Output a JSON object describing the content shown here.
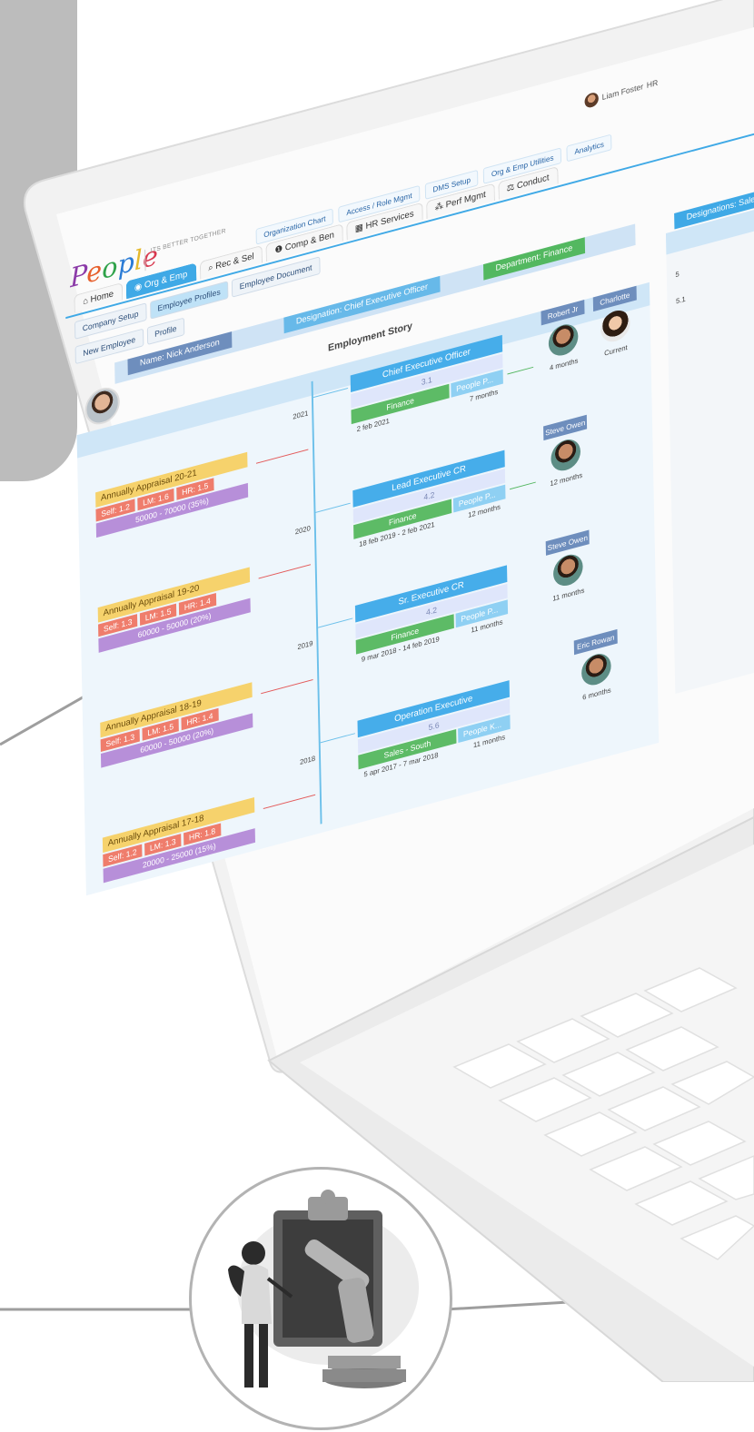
{
  "app": {
    "logo_text": "People",
    "tagline": "ITS BETTER TOGETHER",
    "user": {
      "name": "Liam Foster",
      "role": "HR"
    }
  },
  "main_nav": [
    {
      "label": "Home",
      "icon": "home-icon"
    },
    {
      "label": "Org & Emp",
      "icon": "user-icon"
    },
    {
      "label": "Rec & Sel",
      "icon": "search-icon"
    },
    {
      "label": "Comp & Ben",
      "icon": "coin-icon"
    },
    {
      "label": "HR Services",
      "icon": "calendar-icon"
    },
    {
      "label": "Perf Mgmt",
      "icon": "chart-icon"
    },
    {
      "label": "Conduct",
      "icon": "gavel-icon"
    }
  ],
  "sub_nav": [
    "Organization Chart",
    "Access / Role Mgmt",
    "DMS Setup",
    "Org & Emp Utilities",
    "Analytics"
  ],
  "tabs_row1": [
    "Company Setup",
    "Employee Profiles",
    "Employee Document"
  ],
  "tabs_row2": [
    "New Employee",
    "Profile"
  ],
  "employee": {
    "name": "Name: Nick Anderson",
    "designation": "Designation: Chief Executive Officer",
    "department": "Department: Finance",
    "designation_right": "Designations: Sales Exec"
  },
  "story_title": "Employment Story",
  "years": [
    "2021",
    "2020",
    "2019",
    "2018"
  ],
  "appraisals": [
    {
      "title": "Annually Appraisal 20-21",
      "self": "Self: 1.2",
      "lm": "LM: 1.6",
      "hr": "HR: 1.5",
      "band": "50000 - 70000 (35%)"
    },
    {
      "title": "Annually Appraisal 19-20",
      "self": "Self: 1.3",
      "lm": "LM: 1.5",
      "hr": "HR: 1.4",
      "band": "60000 - 50000 (20%)"
    },
    {
      "title": "Annually Appraisal 18-19",
      "self": "Self: 1.3",
      "lm": "LM: 1.5",
      "hr": "HR: 1.4",
      "band": "60000 - 50000 (20%)"
    },
    {
      "title": "Annually Appraisal 17-18",
      "self": "Self: 1.2",
      "lm": "LM: 1.3",
      "hr": "HR: 1.8",
      "band": "20000 - 25000 (15%)"
    }
  ],
  "roles": [
    {
      "title": "Chief Executive Officer",
      "level": "3.1",
      "dept": "Finance",
      "unit": "People P...",
      "start": "2 feb 2021",
      "duration": "7 months"
    },
    {
      "title": "Lead Executive CR",
      "level": "4.2",
      "dept": "Finance",
      "unit": "People P...",
      "start": "18 feb 2019 - 2 feb 2021",
      "duration": "12 months"
    },
    {
      "title": "Sr. Executive CR",
      "level": "4.2",
      "dept": "Finance",
      "unit": "People P...",
      "start": "9 mar 2018 - 14 feb 2019",
      "duration": "11 months"
    },
    {
      "title": "Operation Executive",
      "level": "5.6",
      "dept": "Sales - South",
      "unit": "People K...",
      "start": "5 apr 2017 - 7 mar 2018",
      "duration": "11 months"
    }
  ],
  "managers": [
    {
      "name": "Robert Jr",
      "duration": "4 months"
    },
    {
      "name": "Charlotte",
      "duration": "Current"
    },
    {
      "name": "Steve Owen",
      "duration": "12 months"
    },
    {
      "name": "Steve Owen",
      "duration": "11 months"
    },
    {
      "name": "Eric Rowan",
      "duration": "6 months"
    }
  ],
  "right_panel": {
    "n1": "5",
    "n2": "5.1"
  }
}
